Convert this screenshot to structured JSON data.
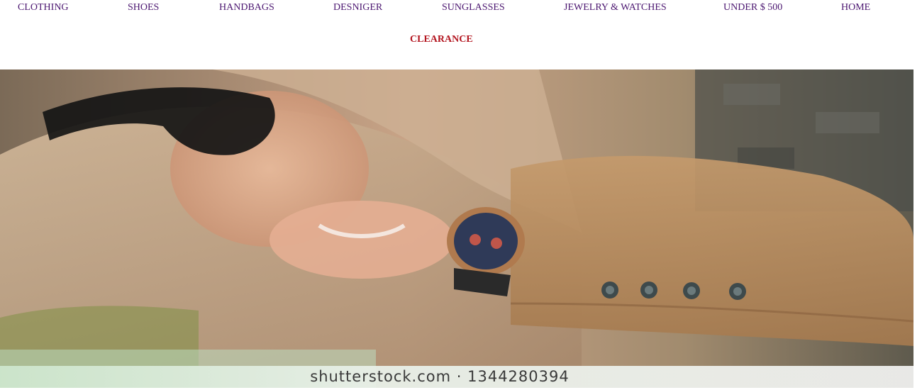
{
  "nav": {
    "items": [
      {
        "label": "CLOTHING"
      },
      {
        "label": "SHOES"
      },
      {
        "label": "HANDBAGS"
      },
      {
        "label": "DESNIGER"
      },
      {
        "label": "SUNGLASSES"
      },
      {
        "label": "JEWELRY & WATCHES"
      },
      {
        "label": "UNDER $ 500"
      },
      {
        "label": "HOME"
      }
    ],
    "clearance": "CLEARANCE"
  },
  "hero": {
    "watermark": "shutterstock.com · 1344280394"
  },
  "colors": {
    "nav_text": "#4b1670",
    "clearance_text": "#b3151f"
  }
}
